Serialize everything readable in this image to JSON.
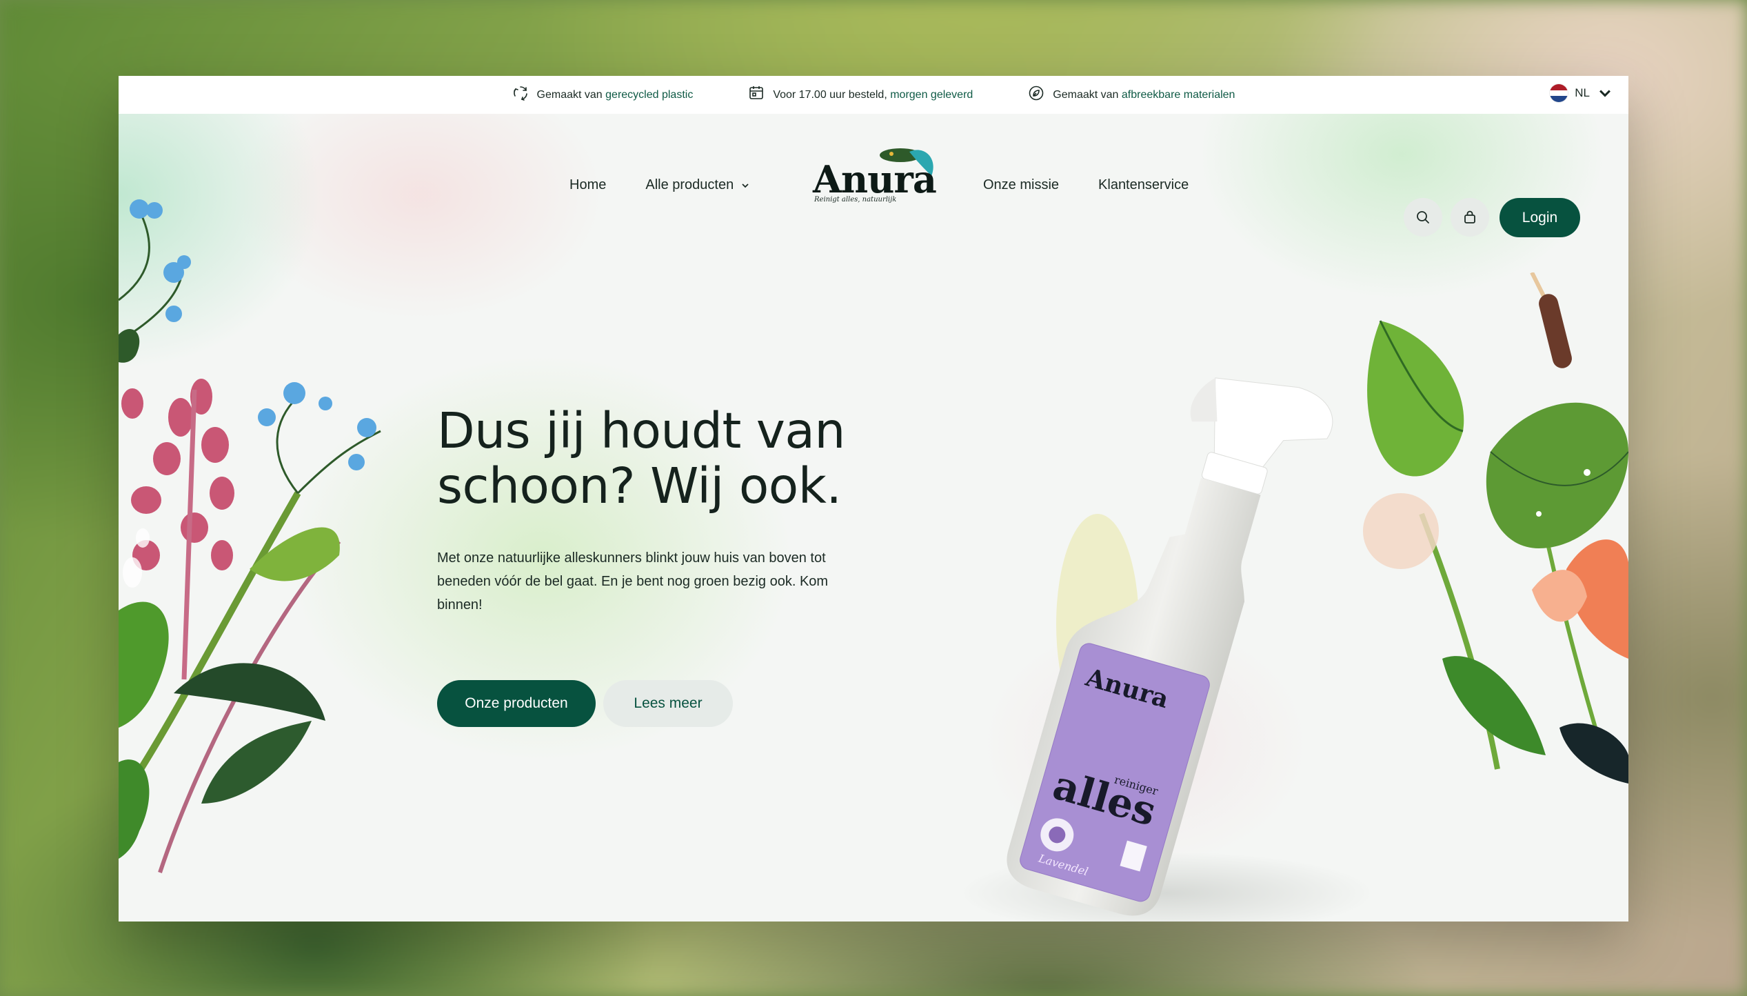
{
  "topbar": {
    "usp1_prefix": "Gemaakt van",
    "usp1_highlight": "gerecycled plastic",
    "usp2_prefix": "Voor 17.00 uur besteld,",
    "usp2_highlight": "morgen geleverd",
    "usp3_prefix": "Gemaakt van",
    "usp3_highlight": "afbreekbare materialen",
    "language": "NL"
  },
  "nav": {
    "home": "Home",
    "products": "Alle producten",
    "mission": "Onze missie",
    "service": "Klantenservice",
    "login": "Login"
  },
  "logo": {
    "name": "Anura",
    "tagline": "Reinigt alles, natuurlijk"
  },
  "hero": {
    "headline_line1": "Dus jij houdt van",
    "headline_line2": "schoon? Wij ook.",
    "intro": "Met onze natuurlijke alleskunners blinkt jouw huis van boven tot beneden vóór de bel gaat. En je bent nog groen bezig ook. Kom binnen!",
    "primary_button": "Onze producten",
    "secondary_button": "Lees meer"
  },
  "product_label": {
    "brand": "Anura",
    "small": "reiniger",
    "big": "alles",
    "scent": "Lavendel"
  },
  "colors": {
    "primary": "#07523f",
    "label_purple": "#a88fd3",
    "text": "#15221d"
  },
  "icons": [
    "recycle-icon",
    "delivery-icon",
    "leaf-icon",
    "flag-nl-icon",
    "chevron-down-icon",
    "search-icon",
    "bag-icon"
  ]
}
